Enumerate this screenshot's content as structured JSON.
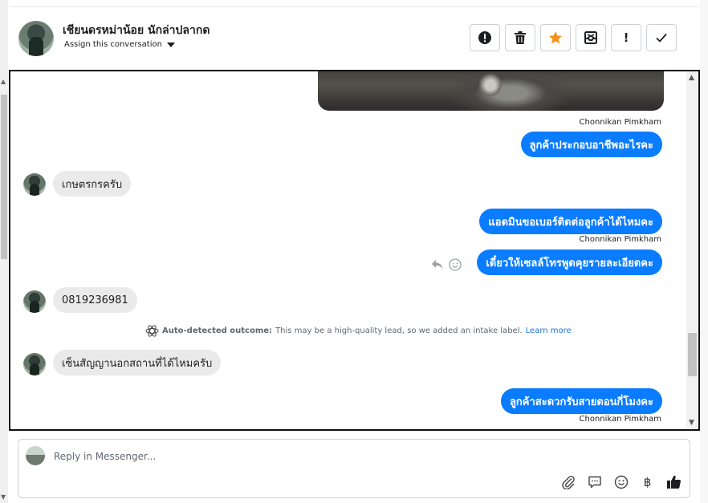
{
  "header": {
    "contact_name": "เชียนดรหม่าน้อย นักล่าปลากด",
    "assign_label": "Assign this conversation"
  },
  "actions": [
    {
      "name": "report-icon"
    },
    {
      "name": "trash-icon"
    },
    {
      "name": "star-icon",
      "color": "#f5911e"
    },
    {
      "name": "archive-icon"
    },
    {
      "name": "exclamation-icon"
    },
    {
      "name": "checkmark-icon"
    }
  ],
  "messages": {
    "m1_sender": "Chonnikan Pimkham",
    "m1_text": "ลูกค้าประกอบอาชีพอะไรคะ",
    "m2_text": "เกษตรกรครับ",
    "m3_text": "แอดมินขอเบอร์ติดต่อลูกค้าได้ไหมคะ",
    "m3_sender": "Chonnikan Pimkham",
    "m4_text": "เดี๋ยวให้เซลล์โทรพูดคุยรายละเอียดคะ",
    "m5_text": "0819236981",
    "m6_text": "เซ็นสัญญานอกสถานที่ได้ไหมครับ",
    "m7_text": "ลูกค้าสะดวกรับสายตอนกี่โมงคะ",
    "m7_sender": "Chonnikan Pimkham"
  },
  "auto_outcome": {
    "title": "Auto-detected outcome:",
    "body": "This may be a high-quality lead, so we added an intake label.",
    "link": "Learn more"
  },
  "composer": {
    "placeholder": "Reply in Messenger..."
  },
  "colors": {
    "outgoing_bubble": "#0a7cff",
    "incoming_bubble": "#eaeaea",
    "star": "#f5911e",
    "link": "#1b74e4"
  }
}
